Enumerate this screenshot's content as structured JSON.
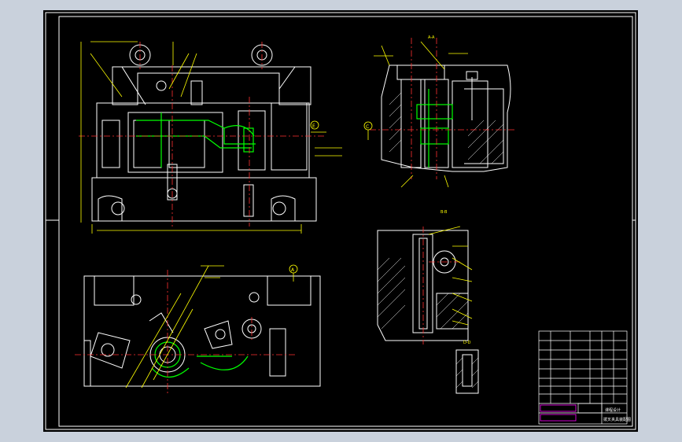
{
  "colors": {
    "viewport_bg": "#c9d1dc",
    "sheet_bg": "#000000",
    "outline": "#ffffff",
    "dimension": "#ffff00",
    "center_line": "#ff3030",
    "hidden_line": "#00ff00",
    "title_block_accent": "#ff00ff",
    "hatch": "#ffffff"
  },
  "views": {
    "section_aa_label": "A-A",
    "section_bb_label": "B-B",
    "section_dd_label": "D-D",
    "datum_c": "C",
    "datum_e": "E",
    "datum_d": "D",
    "datum_a": "A"
  },
  "title_block": {
    "drawing_title": "拨叉夹具装配图",
    "design_label": "课程设计",
    "scale_label": "1:1",
    "school_label": "HIT"
  },
  "icons": {
    "cursor": "crosshair-icon"
  }
}
